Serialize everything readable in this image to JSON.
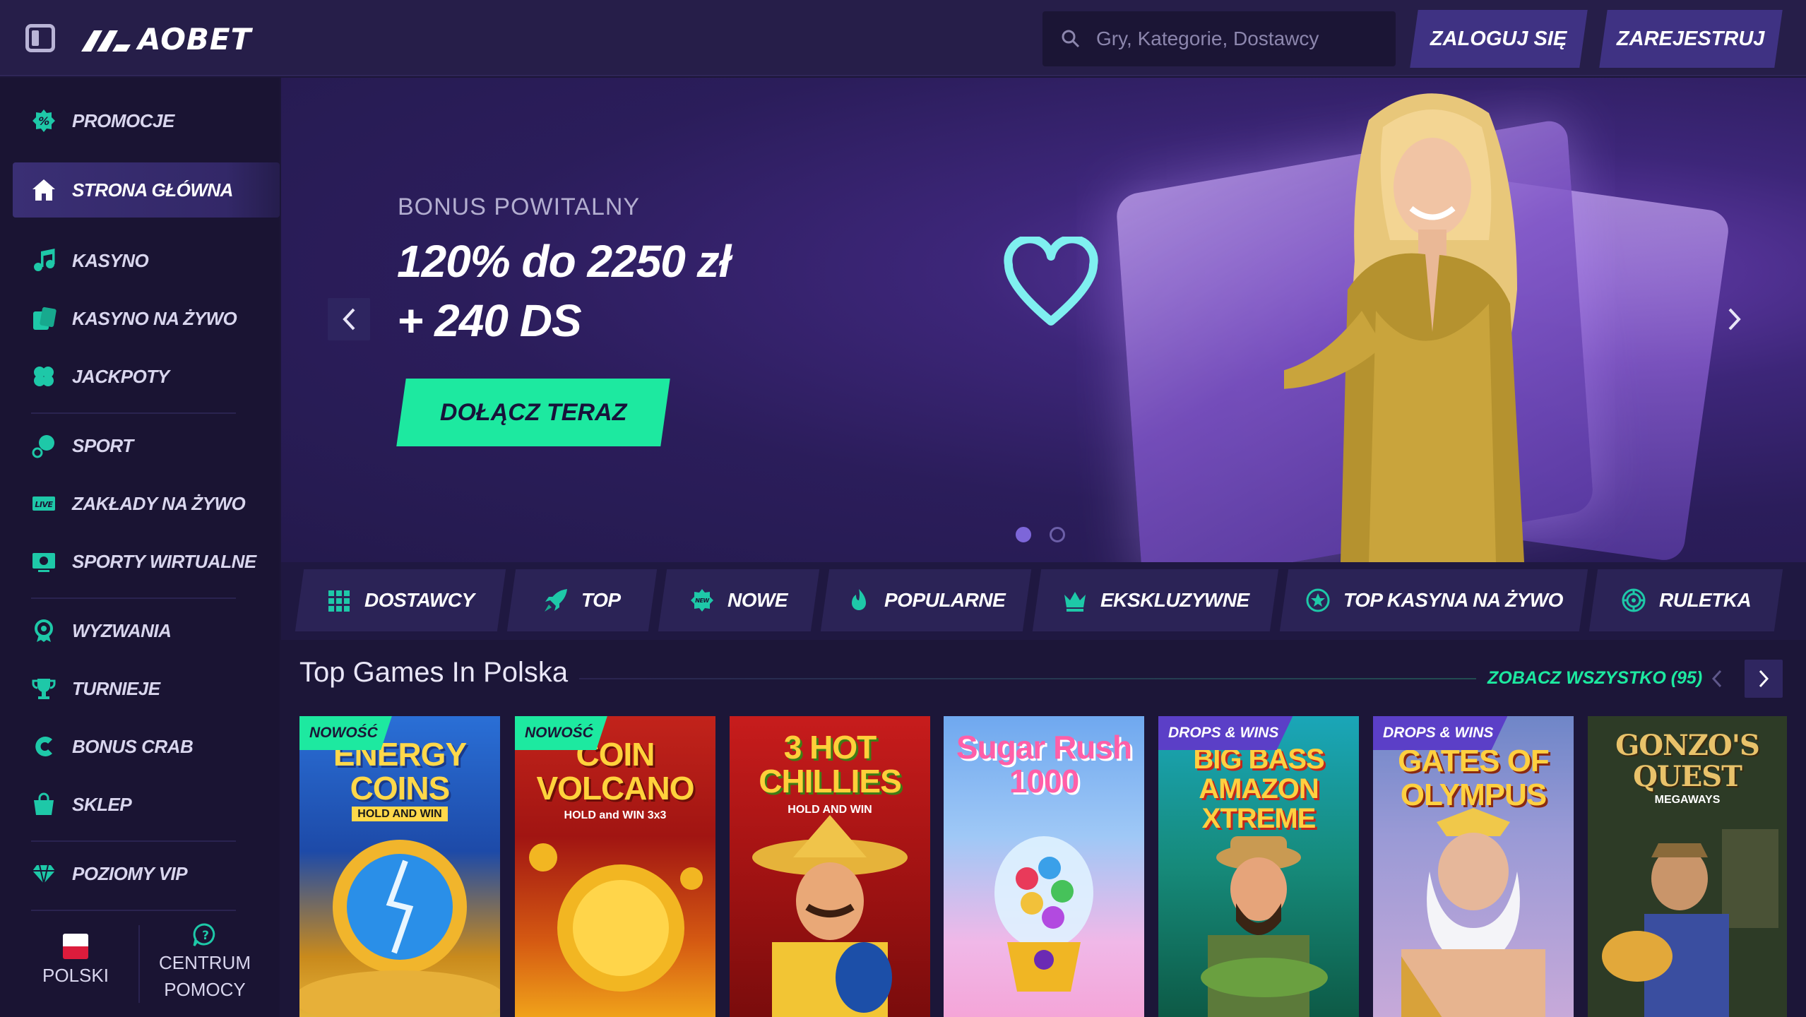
{
  "header": {
    "logo_text": "AOBET",
    "search_placeholder": "Gry, Kategorie, Dostawcy",
    "login_label": "ZALOGUJ SIĘ",
    "register_label": "ZAREJESTRUJ"
  },
  "sidebar": {
    "items": [
      {
        "label": "PROMOCJE",
        "icon": "percent-badge-icon"
      },
      {
        "label": "STRONA GŁÓWNA",
        "icon": "home-icon",
        "active": true
      },
      {
        "label": "KASYNO",
        "icon": "music-note-icon"
      },
      {
        "label": "KASYNO NA ŻYWO",
        "icon": "live-cards-icon"
      },
      {
        "label": "JACKPOTY",
        "icon": "clover-icon"
      },
      {
        "label": "SPORT",
        "icon": "sports-ball-icon"
      },
      {
        "label": "ZAKŁADY NA ŻYWO",
        "icon": "live-badge-icon"
      },
      {
        "label": "SPORTY WIRTUALNE",
        "icon": "virtual-sports-icon"
      },
      {
        "label": "WYZWANIA",
        "icon": "medal-icon"
      },
      {
        "label": "TURNIEJE",
        "icon": "trophy-icon"
      },
      {
        "label": "BONUS CRAB",
        "icon": "claw-icon"
      },
      {
        "label": "SKLEP",
        "icon": "shopping-bag-icon"
      },
      {
        "label": "POZIOMY VIP",
        "icon": "diamond-icon"
      }
    ],
    "language_label": "POLSKI",
    "help_label_line1": "CENTRUM",
    "help_label_line2": "POMOCY"
  },
  "hero": {
    "bonus_label": "BONUS POWITALNY",
    "title_line1": "120% do 2250 zł",
    "title_line2": "+ 240 DS",
    "cta_label": "DOŁĄCZ TERAZ",
    "slide_count": 2,
    "active_slide": 1
  },
  "categories": [
    {
      "label": "DOSTAWCY",
      "icon": "grid-icon"
    },
    {
      "label": "TOP",
      "icon": "rocket-icon"
    },
    {
      "label": "NOWE",
      "icon": "new-badge-icon"
    },
    {
      "label": "POPULARNE",
      "icon": "flame-icon"
    },
    {
      "label": "EKSKLUZYWNE",
      "icon": "crown-icon"
    },
    {
      "label": "TOP KASYNA NA ŻYWO",
      "icon": "star-circle-icon"
    },
    {
      "label": "RULETKA",
      "icon": "roulette-icon"
    }
  ],
  "top_games": {
    "title": "Top Games In Polska",
    "see_all_label": "ZOBACZ WSZYSTKO (95)",
    "games": [
      {
        "title": "ENERGY COINS",
        "subtitle": "HOLD AND WIN",
        "badge": "NOWOŚĆ"
      },
      {
        "title": "COIN VOLCANO",
        "subtitle": "HOLD and WIN 3x3",
        "badge": "NOWOŚĆ"
      },
      {
        "title": "3 HOT CHILLIES",
        "subtitle": "HOLD AND WIN",
        "badge": ""
      },
      {
        "title": "Sugar Rush 1000",
        "subtitle": "",
        "badge": ""
      },
      {
        "title": "BIG BASS AMAZON XTREME",
        "subtitle": "",
        "badge": "DROPS & WINS"
      },
      {
        "title": "GATES OF OLYMPUS",
        "subtitle": "",
        "badge": "DROPS & WINS"
      },
      {
        "title": "GONZO'S QUEST",
        "subtitle": "MEGAWAYS",
        "badge": ""
      }
    ]
  },
  "colors": {
    "accent_green": "#1de9a0",
    "header_bg": "#261e49",
    "sidebar_bg": "#1a1433",
    "button_purple": "#3f3283"
  }
}
